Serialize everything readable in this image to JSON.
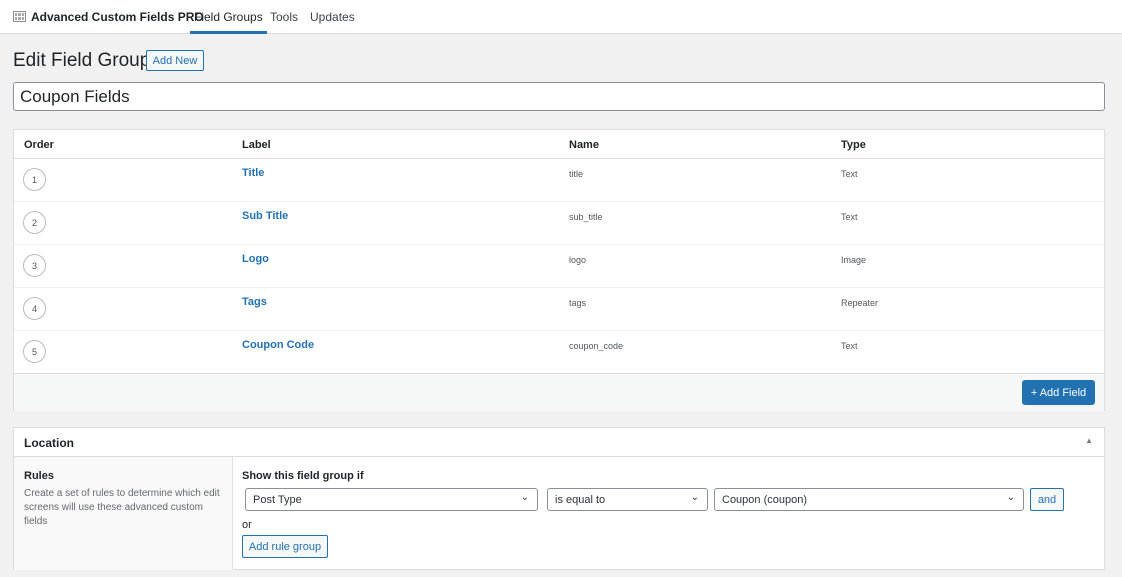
{
  "nav": {
    "brand": "Advanced Custom Fields PRO",
    "tabs": [
      "Field Groups",
      "Tools",
      "Updates"
    ]
  },
  "header": {
    "title": "Edit Field Group",
    "add_new": "Add New"
  },
  "group_title": "Coupon Fields",
  "fields_table": {
    "columns": [
      "Order",
      "Label",
      "Name",
      "Type"
    ],
    "rows": [
      {
        "order": "1",
        "label": "Title",
        "name": "title",
        "type": "Text"
      },
      {
        "order": "2",
        "label": "Sub Title",
        "name": "sub_title",
        "type": "Text"
      },
      {
        "order": "3",
        "label": "Logo",
        "name": "logo",
        "type": "Image"
      },
      {
        "order": "4",
        "label": "Tags",
        "name": "tags",
        "type": "Repeater"
      },
      {
        "order": "5",
        "label": "Coupon Code",
        "name": "coupon_code",
        "type": "Text"
      }
    ],
    "add_field": "+ Add Field"
  },
  "location": {
    "title": "Location",
    "rules_title": "Rules",
    "rules_desc": "Create a set of rules to determine which edit screens will use these advanced custom fields",
    "show_if": "Show this field group if",
    "param": "Post Type",
    "operator": "is equal to",
    "value": "Coupon (coupon)",
    "and": "and",
    "or": "or",
    "add_rule_group": "Add rule group"
  },
  "colors": {
    "accent": "#2271b1",
    "background": "#f1f1f1"
  }
}
